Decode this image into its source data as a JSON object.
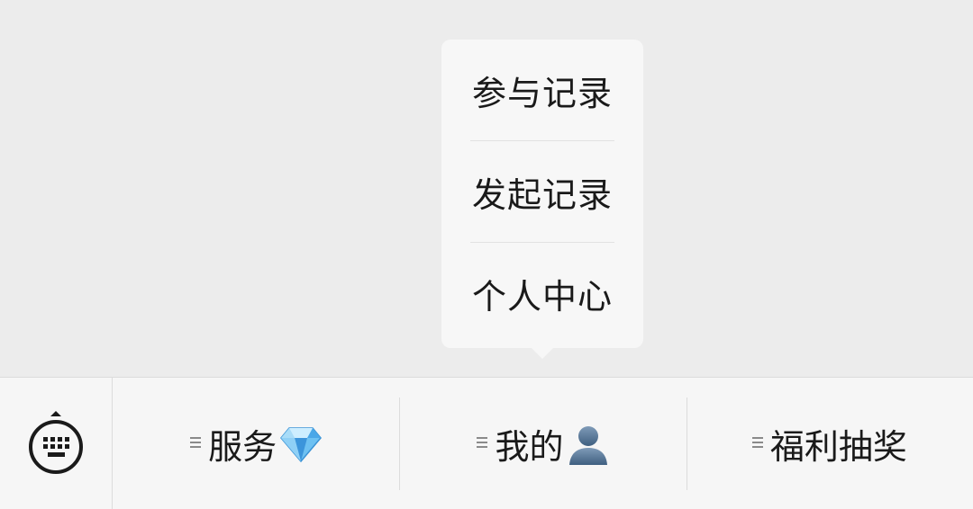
{
  "popup": {
    "items": [
      {
        "label": "参与记录"
      },
      {
        "label": "发起记录"
      },
      {
        "label": "个人中心"
      }
    ]
  },
  "menubar": {
    "keyboard_icon": "keyboard-icon",
    "buttons": [
      {
        "label": "服务",
        "icon": "diamond-icon"
      },
      {
        "label": "我的",
        "icon": "user-silhouette-icon"
      },
      {
        "label": "福利抽奖",
        "icon": ""
      }
    ]
  },
  "colors": {
    "background": "#ececec",
    "popup_bg": "#f7f7f7",
    "menubar_bg": "#f6f6f6",
    "text": "#1a1a1a",
    "diamond": "#4aa7e8",
    "user": "#4f6f8f"
  }
}
